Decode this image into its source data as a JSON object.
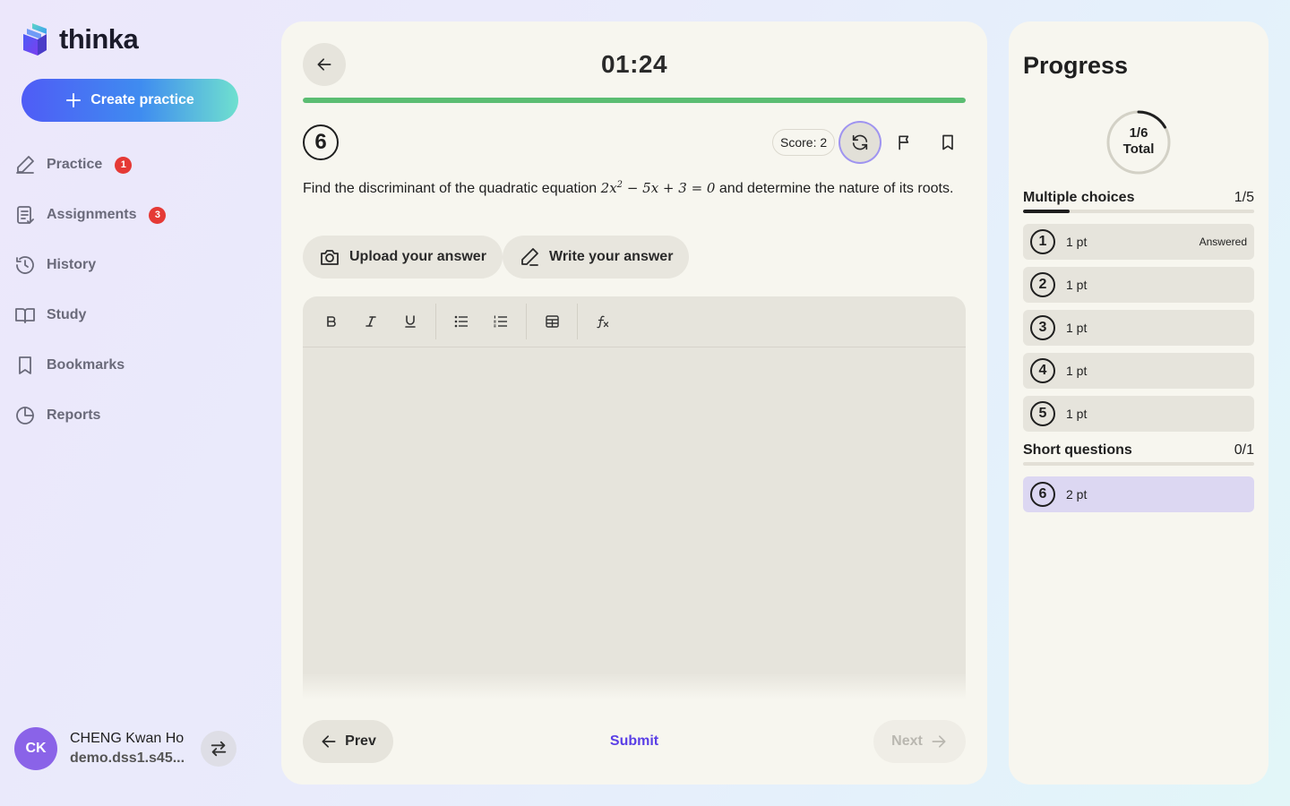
{
  "brand": {
    "name": "thinka"
  },
  "sidebar": {
    "create_label": "Create practice",
    "items": [
      {
        "label": "Practice",
        "badge": "1"
      },
      {
        "label": "Assignments",
        "badge": "3"
      },
      {
        "label": "History"
      },
      {
        "label": "Study"
      },
      {
        "label": "Bookmarks"
      },
      {
        "label": "Reports"
      }
    ],
    "user": {
      "initials": "CK",
      "name": "CHENG Kwan Ho",
      "email": "demo.dss1.s45..."
    }
  },
  "main": {
    "timer": "01:24",
    "progress_fraction": 1.0,
    "question_number": "6",
    "score_label": "Score: 2",
    "question_before": "Find the discriminant of the quadratic equation",
    "question_after": "and determine the nature of its roots.",
    "math": {
      "a": "2x",
      "exp": "2",
      "rest": " − 5x + 3 = 0"
    },
    "upload_label": "Upload your answer",
    "write_label": "Write your answer",
    "prev_label": "Prev",
    "submit_label": "Submit",
    "next_label": "Next"
  },
  "progress": {
    "title": "Progress",
    "ring": {
      "value": "1/6",
      "label": "Total",
      "fraction": 0.1667
    },
    "sections": [
      {
        "title": "Multiple choices",
        "count": "1/5",
        "fraction": 0.2,
        "items": [
          {
            "num": "1",
            "pt": "1 pt",
            "status": "Answered"
          },
          {
            "num": "2",
            "pt": "1 pt",
            "status": ""
          },
          {
            "num": "3",
            "pt": "1 pt",
            "status": ""
          },
          {
            "num": "4",
            "pt": "1 pt",
            "status": ""
          },
          {
            "num": "5",
            "pt": "1 pt",
            "status": ""
          }
        ]
      },
      {
        "title": "Short questions",
        "count": "0/1",
        "fraction": 0.0,
        "items": [
          {
            "num": "6",
            "pt": "2 pt",
            "status": ""
          }
        ]
      }
    ]
  },
  "colors": {
    "accent": "#5a3fe6",
    "progress_green": "#5bbd72",
    "badge_red": "#e53935",
    "avatar": "#8a63e8",
    "current_item": "#dcd7f2"
  }
}
